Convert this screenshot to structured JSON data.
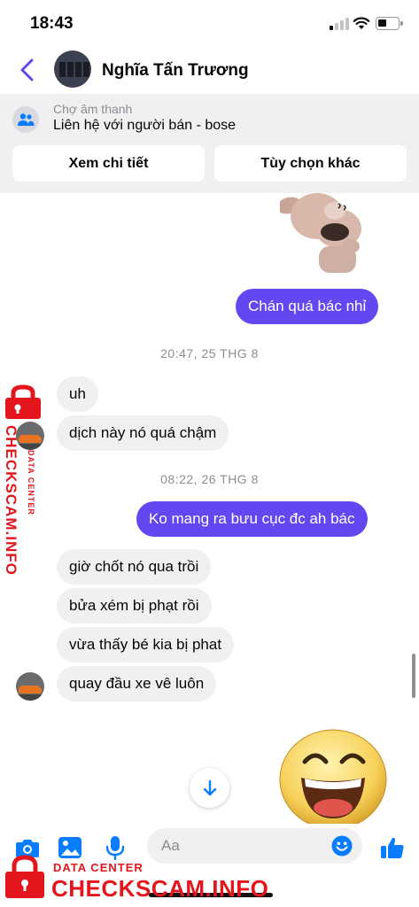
{
  "status_bar": {
    "time": "18:43"
  },
  "header": {
    "contact_name": "Nghĩa Tấn Trương"
  },
  "banner": {
    "subtitle": "Chợ âm thanh",
    "title": "Liên hệ với người bán - bose",
    "details_button": "Xem chi tiết",
    "options_button": "Tùy chọn khác"
  },
  "messages": [
    {
      "type": "sticker",
      "direction": "outgoing",
      "sticker": "dog-facepalm"
    },
    {
      "type": "text",
      "direction": "outgoing",
      "text": "Chán quá bác nhỉ"
    },
    {
      "type": "timestamp",
      "text": "20:47, 25 THG 8"
    },
    {
      "type": "text",
      "direction": "incoming",
      "text": "uh"
    },
    {
      "type": "text",
      "direction": "incoming",
      "text": "dịch này nó quá chậm"
    },
    {
      "type": "timestamp",
      "text": "08:22, 26 THG 8"
    },
    {
      "type": "text",
      "direction": "outgoing",
      "text": "Ko mang ra bưu cục đc ah bác"
    },
    {
      "type": "text",
      "direction": "incoming",
      "text": "giờ chốt nó qua trồi"
    },
    {
      "type": "text",
      "direction": "incoming",
      "text": "bửa xém bị phạt rồi"
    },
    {
      "type": "text",
      "direction": "incoming",
      "text": "vừa thấy bé kia bị phat"
    },
    {
      "type": "text",
      "direction": "incoming",
      "text": "quay đầu xe vê luôn"
    },
    {
      "type": "sticker",
      "direction": "outgoing",
      "sticker": "laughing-emoji"
    }
  ],
  "composer": {
    "placeholder": "Aa",
    "icons": [
      "camera-icon",
      "photo-icon",
      "microphone-icon",
      "emoji-icon",
      "thumbs-up-icon"
    ]
  },
  "watermark": {
    "brand": "CHECKSCAM.INFO",
    "label": "DATA CENTER"
  },
  "colors": {
    "accent": "#6148f0",
    "messenger_blue": "#0a7cff",
    "incoming_bubble": "#f0f0f0",
    "watermark_red": "#e3161d"
  }
}
